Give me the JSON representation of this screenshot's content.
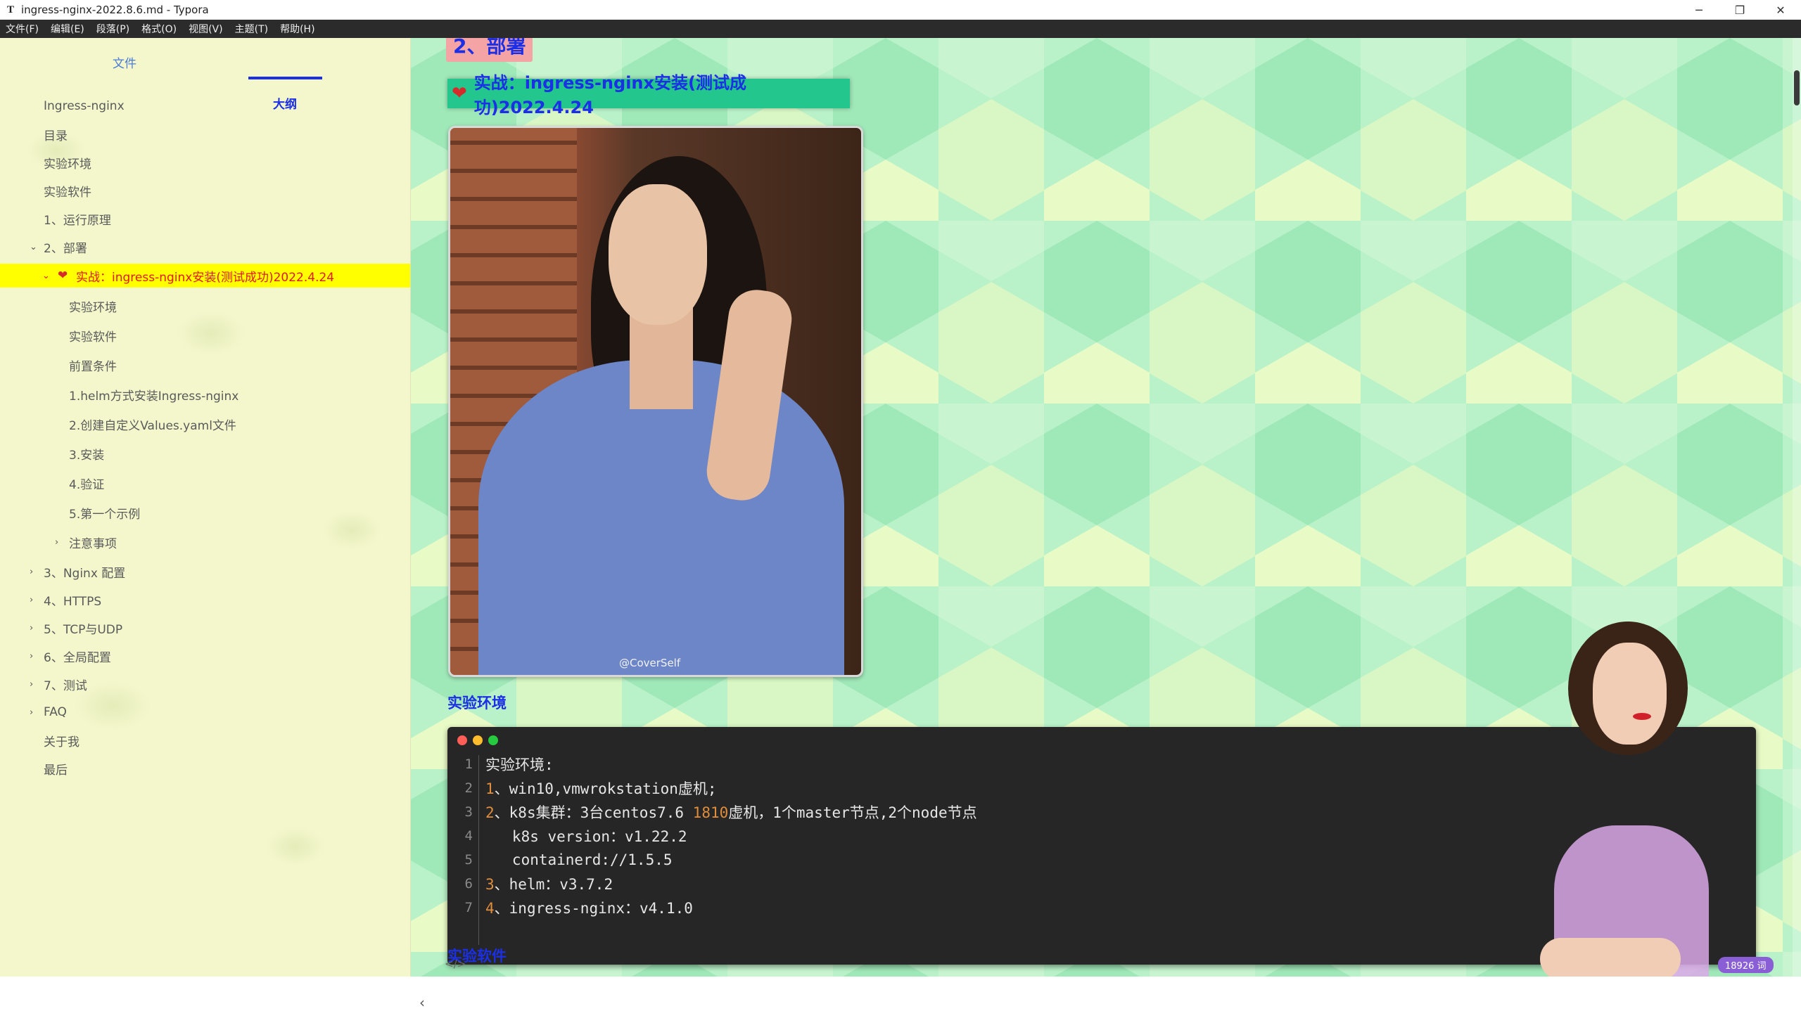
{
  "window": {
    "app_icon": "T",
    "title": "ingress-nginx-2022.8.6.md - Typora",
    "controls": {
      "minimize": "─",
      "restore": "❐",
      "close": "✕"
    }
  },
  "menu": [
    "文件(F)",
    "编辑(E)",
    "段落(P)",
    "格式(O)",
    "视图(V)",
    "主题(T)",
    "帮助(H)"
  ],
  "sidebar": {
    "tabs": {
      "files": "文件",
      "outline": "大纲"
    },
    "outline": [
      {
        "label": "Ingress-nginx",
        "level": 1,
        "chevron": ""
      },
      {
        "label": "目录",
        "level": 1,
        "chevron": ""
      },
      {
        "label": "实验环境",
        "level": 1,
        "chevron": ""
      },
      {
        "label": "实验软件",
        "level": 1,
        "chevron": ""
      },
      {
        "label": "1、运行原理",
        "level": 1,
        "chevron": ""
      },
      {
        "label": "2、部署",
        "level": 1,
        "chevron": "⌄"
      },
      {
        "label": "实战：ingress-nginx安装(测试成功)2022.4.24",
        "level": 2,
        "chevron": "⌄",
        "active": true,
        "heart": "❤"
      },
      {
        "label": "实验环境",
        "level": 3,
        "chevron": ""
      },
      {
        "label": "实验软件",
        "level": 3,
        "chevron": ""
      },
      {
        "label": "前置条件",
        "level": 3,
        "chevron": ""
      },
      {
        "label": "1.helm方式安装Ingress-nginx",
        "level": 3,
        "chevron": ""
      },
      {
        "label": "2.创建自定义Values.yaml文件",
        "level": 3,
        "chevron": ""
      },
      {
        "label": "3.安装",
        "level": 3,
        "chevron": ""
      },
      {
        "label": "4.验证",
        "level": 3,
        "chevron": ""
      },
      {
        "label": "5.第一个示例",
        "level": 3,
        "chevron": ""
      },
      {
        "label": "注意事项",
        "level": 3,
        "chevron": "›"
      },
      {
        "label": "3、Nginx 配置",
        "level": 1,
        "chevron": "›"
      },
      {
        "label": "4、HTTPS",
        "level": 1,
        "chevron": "›"
      },
      {
        "label": "5、TCP与UDP",
        "level": 1,
        "chevron": "›"
      },
      {
        "label": "6、全局配置",
        "level": 1,
        "chevron": "›"
      },
      {
        "label": "7、测试",
        "level": 1,
        "chevron": "›"
      },
      {
        "label": "FAQ",
        "level": 1,
        "chevron": "›"
      },
      {
        "label": "关于我",
        "level": 1,
        "chevron": ""
      },
      {
        "label": "最后",
        "level": 1,
        "chevron": ""
      }
    ],
    "footer": {
      "collapse": "‹",
      "source_toggle": "</>"
    }
  },
  "editor": {
    "h2_partial": "2、部署",
    "h3": {
      "heart": "❤",
      "text": "实战：ingress-nginx安装(测试成功)2022.4.24"
    },
    "photo_watermark": "@CoverSelf",
    "h4_env": "实验环境",
    "h4_soft": "实验软件",
    "code": {
      "dot_colors": [
        "#ff5f56",
        "#ffbd2e",
        "#27c93f"
      ],
      "lines": [
        {
          "n": "1",
          "parts": [
            {
              "t": "实验环境:"
            }
          ]
        },
        {
          "n": "2",
          "parts": [
            {
              "t": "1",
              "num": true
            },
            {
              "t": "、win10,vmwrokstation虚机;"
            }
          ]
        },
        {
          "n": "3",
          "parts": [
            {
              "t": "2",
              "num": true
            },
            {
              "t": "、k8s集群：3台centos7.6 "
            },
            {
              "t": "1810",
              "num": true
            },
            {
              "t": "虚机，1个master节点,2个node节点"
            }
          ]
        },
        {
          "n": "4",
          "parts": [
            {
              "t": "   k8s version：v1.22.2"
            }
          ]
        },
        {
          "n": "5",
          "parts": [
            {
              "t": "   containerd://1.5.5"
            }
          ]
        },
        {
          "n": "6",
          "parts": [
            {
              "t": "3",
              "num": true
            },
            {
              "t": "、helm：v3.7.2"
            }
          ]
        },
        {
          "n": "7",
          "parts": [
            {
              "t": "4",
              "num": true
            },
            {
              "t": "、ingress-nginx：v4.1.0"
            }
          ]
        }
      ]
    },
    "word_count": "18926 词"
  },
  "colors": {
    "accent_blue": "#1b2fe6",
    "active_highlight": "#ffff00",
    "active_text": "#e0191b",
    "h3_bg": "#23c78d",
    "code_bg": "#262626"
  }
}
